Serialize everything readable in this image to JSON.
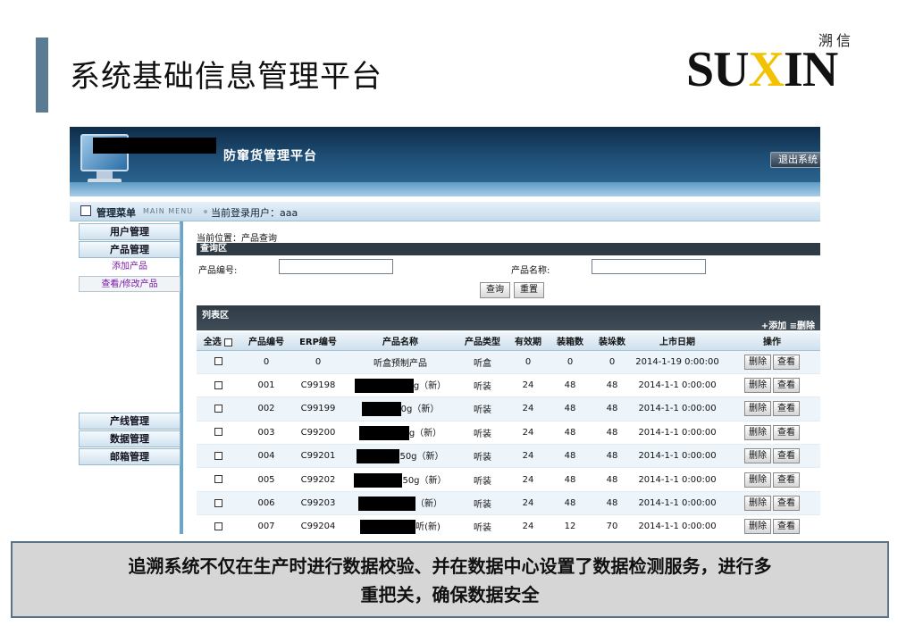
{
  "slide": {
    "title": "系统基础信息管理平台",
    "logo_cn": "溯信",
    "logo_word_pre": "SU",
    "logo_word_x": "X",
    "logo_word_post": "IN",
    "caption_line1": "追溯系统不仅在生产时进行数据校验、并在数据中心设置了数据检测服务，进行多",
    "caption_line2": "重把关，确保数据安全"
  },
  "app": {
    "title": "防窜货管理平台",
    "logout": "退出系统",
    "menu_title": "管理菜单",
    "menu_sub": "MAIN MENU",
    "current_user": "当前登录用户：aaa"
  },
  "sidebar": {
    "items": [
      {
        "label": "用户管理"
      },
      {
        "label": "产品管理"
      },
      {
        "label": "添加产品"
      },
      {
        "label": "查看/修改产品"
      },
      {
        "label": "产线管理"
      },
      {
        "label": "数据管理"
      },
      {
        "label": "邮箱管理"
      }
    ]
  },
  "content": {
    "breadcrumb": "当前位置：产品查询",
    "query_head": "查询区",
    "code_label": "产品编号:",
    "code_value": "",
    "name_label": "产品名称:",
    "name_value": "",
    "search_btn": "查询",
    "reset_btn": "重置",
    "list_head": "列表区",
    "add_btn": "+添加",
    "delete_btn": "≡删除",
    "select_all": "全选",
    "columns": [
      "产品编号",
      "ERP编号",
      "产品名称",
      "产品类型",
      "有效期",
      "装箱数",
      "装垛数",
      "上市日期",
      "操作"
    ],
    "op_delete": "删除",
    "op_view": "查看",
    "rows": [
      {
        "code": "0",
        "erp": "0",
        "name_tail": "听盒预制产品",
        "type": "听盒",
        "valid": "0",
        "box": "0",
        "pile": "0",
        "date": "2014-1-19 0:00:00"
      },
      {
        "code": "001",
        "erp": "C99198",
        "name_tail": "g（新）",
        "type": "听装",
        "valid": "24",
        "box": "48",
        "pile": "48",
        "date": "2014-1-1 0:00:00"
      },
      {
        "code": "002",
        "erp": "C99199",
        "name_tail": "0g（新）",
        "type": "听装",
        "valid": "24",
        "box": "48",
        "pile": "48",
        "date": "2014-1-1 0:00:00"
      },
      {
        "code": "003",
        "erp": "C99200",
        "name_tail": "g（新）",
        "type": "听装",
        "valid": "24",
        "box": "48",
        "pile": "48",
        "date": "2014-1-1 0:00:00"
      },
      {
        "code": "004",
        "erp": "C99201",
        "name_tail": "50g（新）",
        "type": "听装",
        "valid": "24",
        "box": "48",
        "pile": "48",
        "date": "2014-1-1 0:00:00"
      },
      {
        "code": "005",
        "erp": "C99202",
        "name_tail": "50g（新）",
        "type": "听装",
        "valid": "24",
        "box": "48",
        "pile": "48",
        "date": "2014-1-1 0:00:00"
      },
      {
        "code": "006",
        "erp": "C99203",
        "name_tail": "（新）",
        "type": "听装",
        "valid": "24",
        "box": "48",
        "pile": "48",
        "date": "2014-1-1 0:00:00"
      },
      {
        "code": "007",
        "erp": "C99204",
        "name_tail": "听(新)",
        "type": "听装",
        "valid": "24",
        "box": "12",
        "pile": "70",
        "date": "2014-1-1 0:00:00"
      }
    ]
  }
}
